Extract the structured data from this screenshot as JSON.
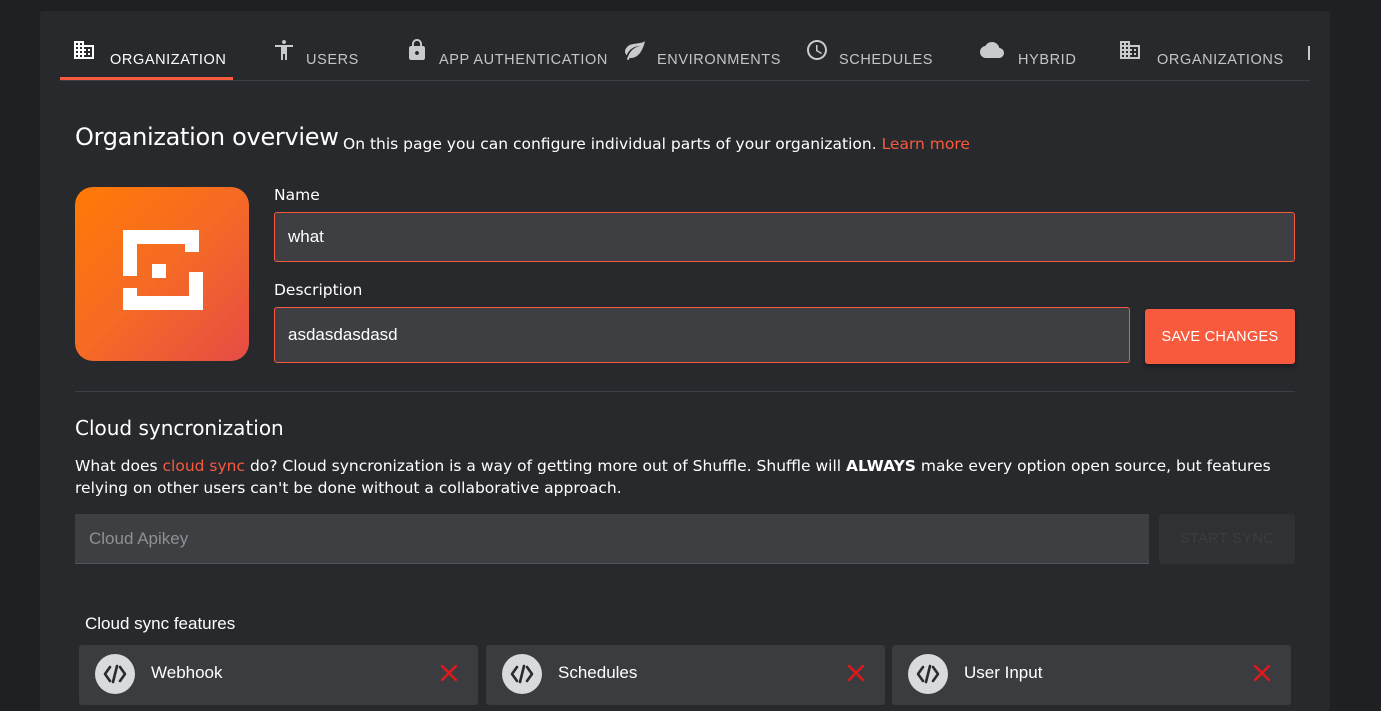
{
  "tabs": [
    {
      "label": "ORGANIZATION",
      "icon": "building-icon",
      "active": true
    },
    {
      "label": "USERS",
      "icon": "person-icon"
    },
    {
      "label": "APP AUTHENTICATION",
      "icon": "lock-icon"
    },
    {
      "label": "ENVIRONMENTS",
      "icon": "leaf-icon"
    },
    {
      "label": "SCHEDULES",
      "icon": "clock-icon"
    },
    {
      "label": "HYBRID",
      "icon": "cloud-icon"
    },
    {
      "label": "ORGANIZATIONS",
      "icon": "building-icon"
    }
  ],
  "overview": {
    "title": "Organization overview",
    "description": "On this page you can configure individual parts of your organization.",
    "learn_more": "Learn more"
  },
  "form": {
    "name_label": "Name",
    "name_value": "what",
    "description_label": "Description",
    "description_value": "asdasdasdasd",
    "save_label": "SAVE CHANGES"
  },
  "cloud": {
    "title": "Cloud syncronization",
    "desc_prefix": "What does ",
    "desc_link": "cloud sync",
    "desc_middle": " do? Cloud syncronization is a way of getting more out of Shuffle. Shuffle will ",
    "desc_bold": "ALWAYS",
    "desc_suffix": " make every option open source, but features relying on other users can't be done without a collaborative approach.",
    "apikey_placeholder": "Cloud Apikey",
    "start_sync_label": "START SYNC",
    "features_title": "Cloud sync features",
    "features": [
      {
        "name": "Webhook",
        "enabled": false
      },
      {
        "name": "Schedules",
        "enabled": false
      },
      {
        "name": "User Input",
        "enabled": false
      }
    ]
  },
  "colors": {
    "accent": "#f85a3e",
    "panel": "#27292d",
    "background": "#1f2023",
    "disabled_x": "#e0191b"
  }
}
